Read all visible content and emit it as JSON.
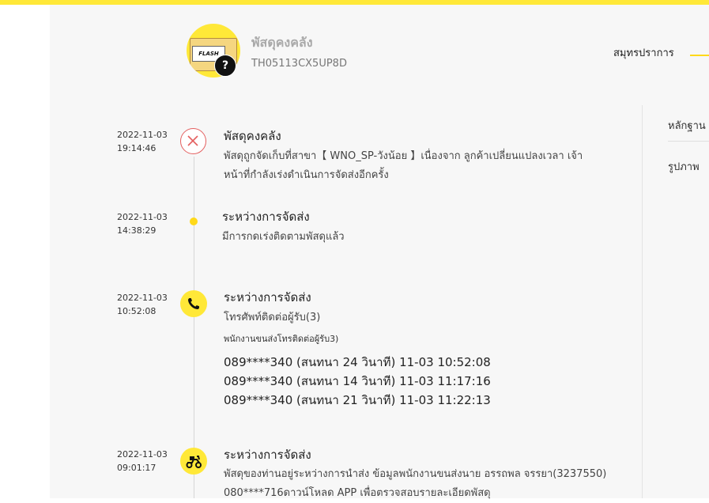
{
  "header": {
    "status_title": "พัสดุคงคลัง",
    "tracking_number": "TH05113CX5UP8D",
    "box_label": "FLASH",
    "tab_summary": "สมุทรปราการ"
  },
  "side": {
    "evidence_label": "หลักฐาน",
    "photo_label": "รูปภาพ"
  },
  "timeline": [
    {
      "date": "2022-11-03",
      "time": "19:14:46",
      "title": "พัสดุคงคลัง",
      "lines": [
        "พัสดุถูกจัดเก็บที่สาขา【 WNO_SP-วังน้อย 】เนื่องจาก ลูกค้าเปลี่ยนแปลงเวลา เจ้า",
        "หน้าที่กำลังเร่งดำเนินการจัดส่งอีกครั้ง"
      ],
      "icon": "x-circle-icon"
    },
    {
      "date": "2022-11-03",
      "time": "14:38:29",
      "title": "ระหว่างการจัดส่ง",
      "lines": [
        "มีการกดเร่งติดตามพัสดุแล้ว"
      ],
      "icon": "dot-icon"
    },
    {
      "date": "2022-11-03",
      "time": "10:52:08",
      "title": "ระหว่างการจัดส่ง",
      "lines": [
        "โทรศัพท์ติดต่อผู้รับ(3)"
      ],
      "note": "พนักงานขนส่งโทรติดต่อผู้รับ3)",
      "calls": [
        "089****340 (สนทนา 24 วินาที) 11-03 10:52:08",
        "089****340 (สนทนา 14 วินาที) 11-03 11:17:16",
        "089****340 (สนทนา 21 วินาที) 11-03 11:22:13"
      ],
      "icon": "phone-icon"
    },
    {
      "date": "2022-11-03",
      "time": "09:01:17",
      "title": "ระหว่างการจัดส่ง",
      "lines": [
        "พัสดุของท่านอยู่ระหว่างการนำส่ง ข้อมูลพนักงานขนส่งนาย อรรถพล จรรยา(3237550)",
        "080****716ดาวน์โหลด APP เพื่อตรวจสอบรายละเอียดพัสดุ"
      ],
      "icon": "scooter-icon"
    }
  ],
  "colors": {
    "brand_yellow": "#ffe838",
    "fail_red": "#e46060"
  }
}
